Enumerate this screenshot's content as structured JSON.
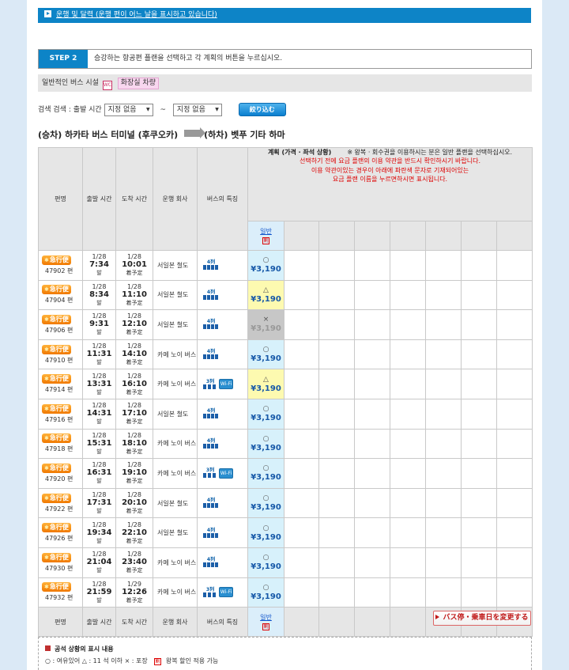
{
  "notice": {
    "text": "운행 및 달력 (운행 편이 어느 날을 표시하고 있습니다)"
  },
  "step": {
    "badge": "STEP 2",
    "instruction": "승강하는 항공편 플랜을 선택하고 각 계획의 버튼을 누르십시오."
  },
  "bus_facility": {
    "label": "일반적인 버스 시설",
    "wc_icon": "WC",
    "tag": "화장실 차량"
  },
  "search": {
    "label": "검색 검색 : 출발 시간",
    "from_value": "지정 없음",
    "tilde": "~",
    "to_value": "지정 없음",
    "button": "絞り込む"
  },
  "route": {
    "from": "(승차) 하카타 버스 터미널 (후쿠오카)",
    "to": "(하차) 벳푸 기타 하마"
  },
  "table": {
    "headers": {
      "bin": "편명",
      "dep": "출발 시간",
      "arr": "도착 시간",
      "company": "운행 회사",
      "feature": "버스의 특징",
      "plan_title": "계획 (가격 · 좌석 상황)",
      "plan_note1": "※ 왕복 · 회수권을 이용하시는 분은 일반 플랜을 선택하십시오.",
      "plan_note2": "선택하기 전에 요금 플랜의 이용 약관을 반드시 확인하시기 바랍니다.",
      "plan_note3": "이용 약관이있는 경우이 아래에 파란색 문자로 기재되어있는",
      "plan_note4": "요금 플랜 이름을 누르면하시면 표시됩니다.",
      "plan_name": "일반",
      "wari_icon": "割"
    },
    "express_label": "急行便",
    "dep_suffix": "발",
    "arr_suffix": "着予定",
    "feature_seat4": "4列",
    "feature_seat3": "3列",
    "feature_wifi": "Wi-Fi",
    "rows": [
      {
        "num": "47902 편",
        "dep_date": "1/28",
        "dep_time": "7:34",
        "arr_date": "1/28",
        "arr_time": "10:01",
        "company": "서일본 철도",
        "seat": "4",
        "wifi": false,
        "mark": "○",
        "price": "¥3,190",
        "status": "ok"
      },
      {
        "num": "47904 편",
        "dep_date": "1/28",
        "dep_time": "8:34",
        "arr_date": "1/28",
        "arr_time": "11:10",
        "company": "서일본 철도",
        "seat": "4",
        "wifi": false,
        "mark": "△",
        "price": "¥3,190",
        "status": "few"
      },
      {
        "num": "47906 편",
        "dep_date": "1/28",
        "dep_time": "9:31",
        "arr_date": "1/28",
        "arr_time": "12:10",
        "company": "서일본 철도",
        "seat": "4",
        "wifi": false,
        "mark": "×",
        "price": "¥3,190",
        "status": "full"
      },
      {
        "num": "47910 편",
        "dep_date": "1/28",
        "dep_time": "11:31",
        "arr_date": "1/28",
        "arr_time": "14:10",
        "company": "카메 노이 버스",
        "seat": "4",
        "wifi": false,
        "mark": "○",
        "price": "¥3,190",
        "status": "ok"
      },
      {
        "num": "47914 편",
        "dep_date": "1/28",
        "dep_time": "13:31",
        "arr_date": "1/28",
        "arr_time": "16:10",
        "company": "카메 노이 버스",
        "seat": "3",
        "wifi": true,
        "mark": "△",
        "price": "¥3,190",
        "status": "few"
      },
      {
        "num": "47916 편",
        "dep_date": "1/28",
        "dep_time": "14:31",
        "arr_date": "1/28",
        "arr_time": "17:10",
        "company": "서일본 철도",
        "seat": "4",
        "wifi": false,
        "mark": "○",
        "price": "¥3,190",
        "status": "ok"
      },
      {
        "num": "47918 편",
        "dep_date": "1/28",
        "dep_time": "15:31",
        "arr_date": "1/28",
        "arr_time": "18:10",
        "company": "카메 노이 버스",
        "seat": "4",
        "wifi": false,
        "mark": "○",
        "price": "¥3,190",
        "status": "ok"
      },
      {
        "num": "47920 편",
        "dep_date": "1/28",
        "dep_time": "16:31",
        "arr_date": "1/28",
        "arr_time": "19:10",
        "company": "카메 노이 버스",
        "seat": "3",
        "wifi": true,
        "mark": "○",
        "price": "¥3,190",
        "status": "ok"
      },
      {
        "num": "47922 편",
        "dep_date": "1/28",
        "dep_time": "17:31",
        "arr_date": "1/28",
        "arr_time": "20:10",
        "company": "서일본 철도",
        "seat": "4",
        "wifi": false,
        "mark": "○",
        "price": "¥3,190",
        "status": "ok"
      },
      {
        "num": "47926 편",
        "dep_date": "1/28",
        "dep_time": "19:34",
        "arr_date": "1/28",
        "arr_time": "22:10",
        "company": "서일본 철도",
        "seat": "4",
        "wifi": false,
        "mark": "○",
        "price": "¥3,190",
        "status": "ok"
      },
      {
        "num": "47930 편",
        "dep_date": "1/28",
        "dep_time": "21:04",
        "arr_date": "1/28",
        "arr_time": "23:40",
        "company": "카메 노이 버스",
        "seat": "4",
        "wifi": false,
        "mark": "○",
        "price": "¥3,190",
        "status": "ok"
      },
      {
        "num": "47932 편",
        "dep_date": "1/28",
        "dep_time": "21:59",
        "arr_date": "1/29",
        "arr_time": "12:26",
        "company": "카메 노이 버스",
        "seat": "3",
        "wifi": true,
        "mark": "○",
        "price": "¥3,190",
        "status": "ok"
      }
    ]
  },
  "change_button": "バス停・乗車日を変更する",
  "legend": {
    "title": "공석 상황의 표시 내용",
    "line1": "○ : 여유있어 △ : 11 석 이하 × : 포장",
    "wari_text": "왕복 할인 적용 가능"
  },
  "colors": {
    "brand_blue": "#0d84c7",
    "seat_ok": "#d7f1fb",
    "seat_few": "#fdfab0",
    "seat_full": "#c7c7c7",
    "express_orange": "#f07800"
  }
}
